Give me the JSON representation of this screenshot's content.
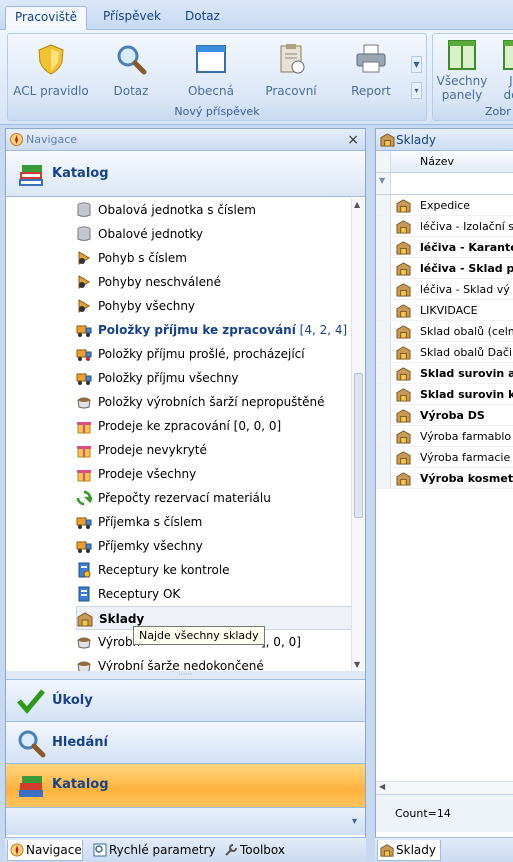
{
  "ribbon": {
    "tabs": [
      "Pracoviště",
      "Příspěvek",
      "Dotaz"
    ],
    "group_label": "Nový příspěvek",
    "buttons": [
      "ACL pravidlo",
      "Dotaz",
      "Obecná",
      "Pracovní",
      "Report"
    ],
    "group2_label": "Zobr",
    "group2_buttons": [
      {
        "line1": "Všechny",
        "line2": "panely"
      },
      {
        "line1": "Jer",
        "line2": "deta"
      }
    ]
  },
  "navigation": {
    "title": "Navigace",
    "close": "×",
    "section": "Katalog",
    "tree_items": [
      {
        "label": "Obalová jednotka s číslem",
        "icon": "database-icon"
      },
      {
        "label": "Obalové jednotky",
        "icon": "database-icon"
      },
      {
        "label": "Pohyb s číslem",
        "icon": "movement-icon"
      },
      {
        "label": "Pohyby neschválené",
        "icon": "movement-icon"
      },
      {
        "label": "Pohyby všechny",
        "icon": "movement-icon"
      },
      {
        "label": "Položky příjmu ke zpracování",
        "icon": "truck-icon",
        "suffix": "[4, 2, 4]"
      },
      {
        "label": "Položky příjmu prošlé, procházející",
        "icon": "truck-icon"
      },
      {
        "label": "Položky příjmu všechny",
        "icon": "truck-icon"
      },
      {
        "label": "Položky výrobních šarží nepropuštěné",
        "icon": "batch-icon"
      },
      {
        "label": "Prodeje ke zpracování [0, 0, 0]",
        "icon": "gift-icon"
      },
      {
        "label": "Prodeje nevykryté",
        "icon": "gift-icon"
      },
      {
        "label": "Prodeje všechny",
        "icon": "gift-icon"
      },
      {
        "label": "Přepočty rezervací materiálu",
        "icon": "recycle-icon"
      },
      {
        "label": "Příjemka s číslem",
        "icon": "truck-icon"
      },
      {
        "label": "Příjemky všechny",
        "icon": "truck-icon"
      },
      {
        "label": "Receptury ke kontrole",
        "icon": "recipe-icon"
      },
      {
        "label": "Receptury OK",
        "icon": "recipe-icon"
      },
      {
        "label": "Sklady",
        "icon": "warehouse-icon"
      },
      {
        "label": "Výrobn",
        "icon": "batch-icon",
        "tail": "], 0, 0]"
      },
      {
        "label": "Výrobní šarže nedokončené",
        "icon": "batch-icon"
      }
    ],
    "tooltip": "Najde všechny sklady",
    "nav_buttons": [
      "Úkoly",
      "Hledání",
      "Katalog"
    ],
    "bottom_tabs": [
      "Navigace",
      "Rychlé parametry",
      "Toolbox"
    ],
    "more_glyph": "▾"
  },
  "grid": {
    "title": "Sklady",
    "column": "Název",
    "rows": [
      {
        "label": "Expedice",
        "bold": false
      },
      {
        "label": "léčiva - Izolační s",
        "bold": false
      },
      {
        "label": "léčiva - Karante",
        "bold": true
      },
      {
        "label": "léčiva - Sklad p",
        "bold": true
      },
      {
        "label": "léčiva - Sklad vý",
        "bold": false
      },
      {
        "label": "LIKVIDACE",
        "bold": false
      },
      {
        "label": "Sklad obalů (celn",
        "bold": false
      },
      {
        "label": "Sklad obalů Dači",
        "bold": false
      },
      {
        "label": "Sklad surovin a",
        "bold": true
      },
      {
        "label": "Sklad surovin k",
        "bold": true
      },
      {
        "label": "Výroba DS",
        "bold": true
      },
      {
        "label": "Výroba farmablo",
        "bold": false
      },
      {
        "label": "Výroba farmacie",
        "bold": false
      },
      {
        "label": "Výroba kosmet",
        "bold": true
      }
    ],
    "count": "Count=14",
    "bottom_tab": "Sklady"
  }
}
